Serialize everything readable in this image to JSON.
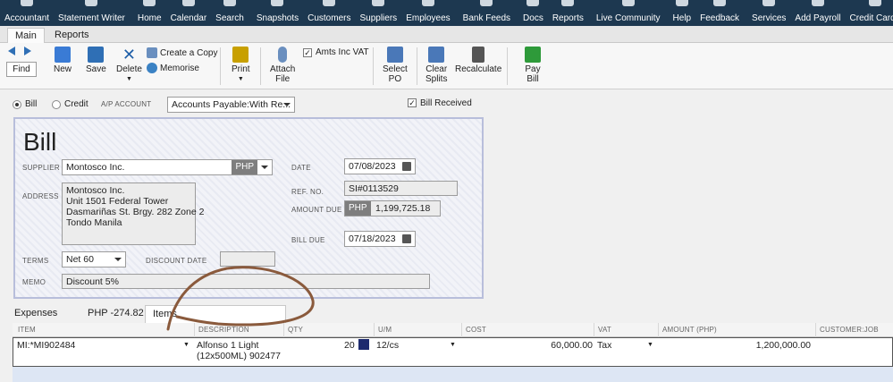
{
  "nav": {
    "items": [
      {
        "label": "Accountant",
        "icon": "accountant-icon"
      },
      {
        "label": "Statement Writer",
        "icon": "statement-writer-icon"
      },
      {
        "label": "Home",
        "icon": "home-icon"
      },
      {
        "label": "Calendar",
        "icon": "calendar-icon"
      },
      {
        "label": "Search",
        "icon": "search-icon"
      },
      {
        "label": "Snapshots",
        "icon": "snapshots-icon"
      },
      {
        "label": "Customers",
        "icon": "customers-icon"
      },
      {
        "label": "Suppliers",
        "icon": "suppliers-icon"
      },
      {
        "label": "Employees",
        "icon": "employees-icon"
      },
      {
        "label": "Bank Feeds",
        "icon": "bank-feeds-icon"
      },
      {
        "label": "Docs",
        "icon": "docs-icon"
      },
      {
        "label": "Reports",
        "icon": "reports-icon"
      },
      {
        "label": "Live Community",
        "icon": "live-community-icon"
      },
      {
        "label": "Help",
        "icon": "help-icon"
      },
      {
        "label": "Feedback",
        "icon": "feedback-icon"
      },
      {
        "label": "Services",
        "icon": "services-icon"
      },
      {
        "label": "Add Payroll",
        "icon": "add-payroll-icon"
      },
      {
        "label": "Credit Cards",
        "icon": "credit-cards-icon"
      }
    ]
  },
  "tabs": {
    "main": "Main",
    "reports": "Reports"
  },
  "toolbar": {
    "find": "Find",
    "new": "New",
    "save": "Save",
    "delete": "Delete",
    "create_copy": "Create a Copy",
    "memorise": "Memorise",
    "print": "Print",
    "attach_file_1": "Attach",
    "attach_file_2": "File",
    "amts_inc_vat": "Amts Inc VAT",
    "select_po_1": "Select",
    "select_po_2": "PO",
    "clear_splits_1": "Clear",
    "clear_splits_2": "Splits",
    "recalculate": "Recalculate",
    "pay_bill_1": "Pay",
    "pay_bill_2": "Bill",
    "colors": {
      "new": "#3a7bd5",
      "save": "#2f6fb5",
      "delete": "#1f5fa8",
      "print": "#c8a000",
      "attach": "#6a8fbf",
      "select_po": "#4a78b8",
      "clear": "#4a78b8",
      "recalc": "#555555",
      "pay": "#2e9a3a"
    }
  },
  "mode": {
    "bill": "Bill",
    "credit": "Credit",
    "ap_account_label": "A/P ACCOUNT",
    "ap_account_value": "Accounts Payable:With Re...",
    "bill_received": "Bill Received"
  },
  "form": {
    "title": "Bill",
    "supplier_label": "SUPPLIER",
    "supplier_value": "Montosco Inc.",
    "currency": "PHP",
    "address_label": "ADDRESS",
    "address_lines": [
      "Montosco Inc.",
      "Unit 1501 Federal Tower",
      "Dasmariñas St. Brgy. 282 Zone 2",
      "Tondo Manila"
    ],
    "date_label": "DATE",
    "date_value": "07/08/2023",
    "ref_label": "REF. NO.",
    "ref_value": "SI#0113529",
    "amount_due_label": "AMOUNT DUE",
    "amount_due_value": "1,199,725.18",
    "bill_due_label": "BILL DUE",
    "bill_due_value": "07/18/2023",
    "terms_label": "TERMS",
    "terms_value": "Net 60",
    "discount_date_label": "DISCOUNT DATE",
    "memo_label": "MEMO",
    "memo_value": "Discount 5%"
  },
  "detail_tabs": {
    "expenses": "Expenses",
    "expenses_amount": "PHP  -274.82",
    "items": "Items"
  },
  "grid": {
    "columns": [
      "ITEM",
      "DESCRIPTION",
      "QTY",
      "U/M",
      "COST",
      "VAT",
      "AMOUNT (PHP)",
      "CUSTOMER:JOB"
    ],
    "rows": [
      {
        "item": "MI:*MI902484",
        "description_1": "Alfonso 1 Light",
        "description_2": "(12x500ML) 902477",
        "qty": "20",
        "um": "12/cs",
        "cost": "60,000.00",
        "vat": "Tax",
        "amount": "1,200,000.00",
        "customer_job": ""
      }
    ]
  },
  "colors": {
    "topbar": "#1d3850",
    "form_border": "#b8bedb",
    "annotation": "#8a5a3c",
    "empty_row": "#dde6f4"
  }
}
